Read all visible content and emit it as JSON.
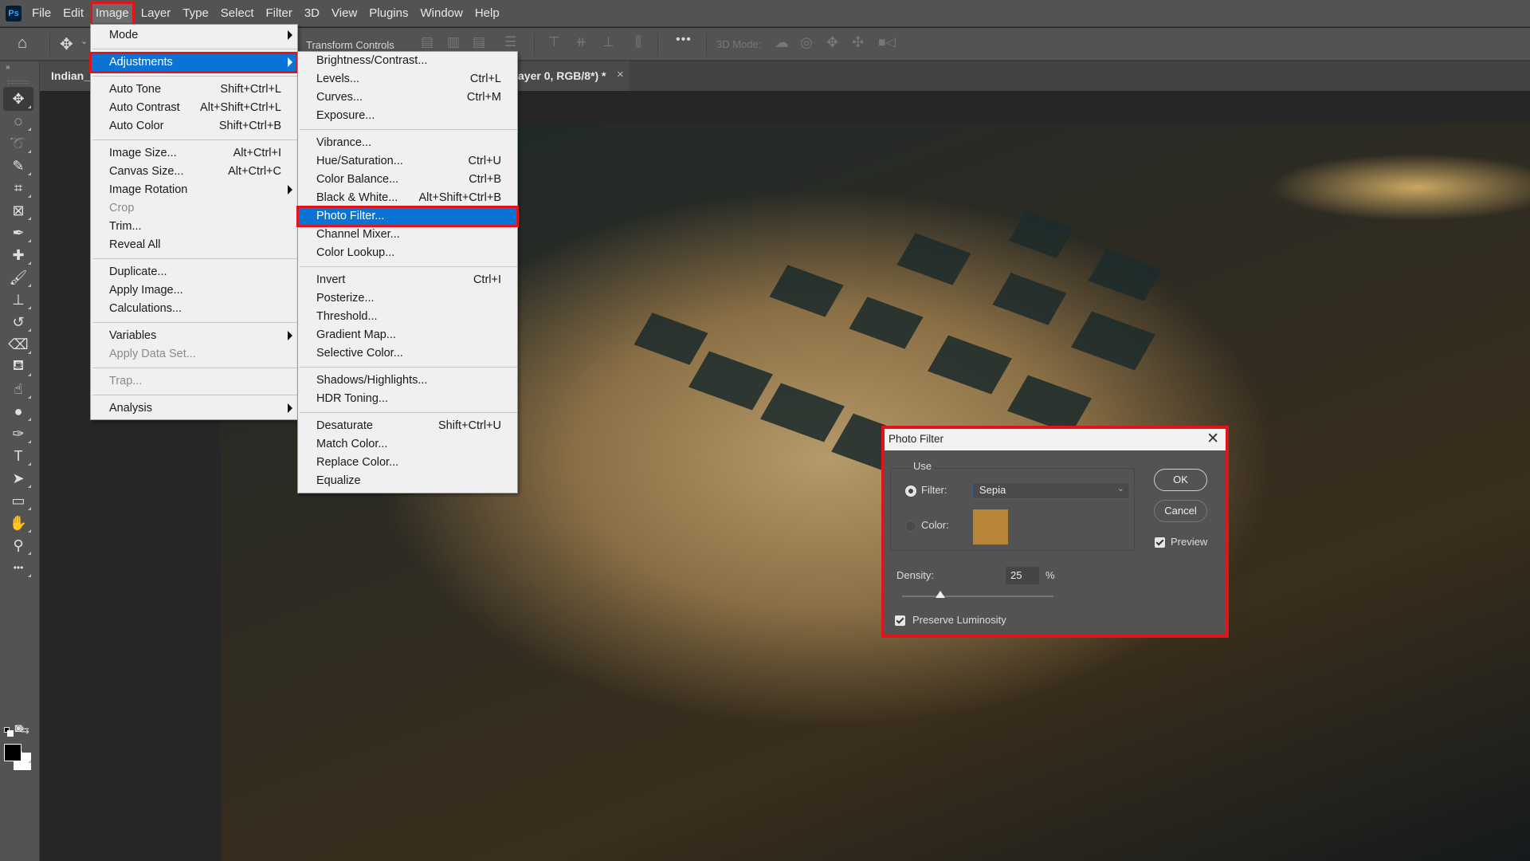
{
  "app": {
    "logo": "Ps"
  },
  "menubar": {
    "items": [
      "File",
      "Edit",
      "Image",
      "Layer",
      "Type",
      "Select",
      "Filter",
      "3D",
      "View",
      "Plugins",
      "Window",
      "Help"
    ],
    "active": "Image"
  },
  "options_bar": {
    "transform_controls_label": "Transform Controls",
    "mode_3d_label": "3D Mode:",
    "icons": [
      "home-icon",
      "move-icon",
      "align-left-icon",
      "align-center-h-icon",
      "align-right-icon",
      "distribute-h-icon",
      "align-top-icon",
      "align-middle-v-icon",
      "align-bottom-icon",
      "distribute-v-icon",
      "more-icon",
      "orbit-3d-icon",
      "roll-3d-icon",
      "pan-3d-icon",
      "slide-3d-icon",
      "scale-3d-icon"
    ]
  },
  "document_tab": {
    "title_prefix": "Indian_",
    "title_suffix": "ayer 0, RGB/8*) *",
    "close": "×"
  },
  "toolbar": {
    "collapse": "»",
    "tools": [
      {
        "name": "move-tool",
        "glyph": "✥"
      },
      {
        "name": "marquee-tool",
        "glyph": "◌"
      },
      {
        "name": "lasso-tool",
        "glyph": "➰"
      },
      {
        "name": "quick-selection-tool",
        "glyph": "✎"
      },
      {
        "name": "crop-tool",
        "glyph": "⌗"
      },
      {
        "name": "frame-tool",
        "glyph": "⊠"
      },
      {
        "name": "eyedropper-tool",
        "glyph": "✒"
      },
      {
        "name": "healing-brush-tool",
        "glyph": "✚"
      },
      {
        "name": "brush-tool",
        "glyph": "🖌"
      },
      {
        "name": "clone-stamp-tool",
        "glyph": "⊥"
      },
      {
        "name": "history-brush-tool",
        "glyph": "↺"
      },
      {
        "name": "eraser-tool",
        "glyph": "⌫"
      },
      {
        "name": "paint-bucket-tool",
        "glyph": "⛾"
      },
      {
        "name": "blur-tool",
        "glyph": "☝"
      },
      {
        "name": "dodge-tool",
        "glyph": "●"
      },
      {
        "name": "pen-tool",
        "glyph": "✑"
      },
      {
        "name": "type-tool",
        "glyph": "T"
      },
      {
        "name": "path-selection-tool",
        "glyph": "➤"
      },
      {
        "name": "rectangle-tool",
        "glyph": "▭"
      },
      {
        "name": "hand-tool",
        "glyph": "✋"
      },
      {
        "name": "zoom-tool",
        "glyph": "⚲"
      },
      {
        "name": "edit-toolbar",
        "glyph": "•••"
      }
    ],
    "foreground_color": "#000000",
    "background_color": "#ffffff"
  },
  "image_menu": {
    "items": [
      {
        "label": "Mode",
        "submenu": true
      },
      {
        "sep": true
      },
      {
        "label": "Adjustments",
        "submenu": true,
        "highlighted": true
      },
      {
        "sep": true
      },
      {
        "label": "Auto Tone",
        "shortcut": "Shift+Ctrl+L"
      },
      {
        "label": "Auto Contrast",
        "shortcut": "Alt+Shift+Ctrl+L"
      },
      {
        "label": "Auto Color",
        "shortcut": "Shift+Ctrl+B"
      },
      {
        "sep": true
      },
      {
        "label": "Image Size...",
        "shortcut": "Alt+Ctrl+I"
      },
      {
        "label": "Canvas Size...",
        "shortcut": "Alt+Ctrl+C"
      },
      {
        "label": "Image Rotation",
        "submenu": true
      },
      {
        "label": "Crop",
        "disabled": true
      },
      {
        "label": "Trim..."
      },
      {
        "label": "Reveal All"
      },
      {
        "sep": true
      },
      {
        "label": "Duplicate..."
      },
      {
        "label": "Apply Image..."
      },
      {
        "label": "Calculations..."
      },
      {
        "sep": true
      },
      {
        "label": "Variables",
        "submenu": true
      },
      {
        "label": "Apply Data Set...",
        "disabled": true
      },
      {
        "sep": true
      },
      {
        "label": "Trap...",
        "disabled": true
      },
      {
        "sep": true
      },
      {
        "label": "Analysis",
        "submenu": true
      }
    ]
  },
  "adjustments_menu": {
    "items": [
      {
        "label": "Brightness/Contrast..."
      },
      {
        "label": "Levels...",
        "shortcut": "Ctrl+L"
      },
      {
        "label": "Curves...",
        "shortcut": "Ctrl+M"
      },
      {
        "label": "Exposure..."
      },
      {
        "sep": true
      },
      {
        "label": "Vibrance..."
      },
      {
        "label": "Hue/Saturation...",
        "shortcut": "Ctrl+U"
      },
      {
        "label": "Color Balance...",
        "shortcut": "Ctrl+B"
      },
      {
        "label": "Black & White...",
        "shortcut": "Alt+Shift+Ctrl+B"
      },
      {
        "label": "Photo Filter...",
        "highlighted": true
      },
      {
        "label": "Channel Mixer..."
      },
      {
        "label": "Color Lookup..."
      },
      {
        "sep": true
      },
      {
        "label": "Invert",
        "shortcut": "Ctrl+I"
      },
      {
        "label": "Posterize..."
      },
      {
        "label": "Threshold..."
      },
      {
        "label": "Gradient Map..."
      },
      {
        "label": "Selective Color..."
      },
      {
        "sep": true
      },
      {
        "label": "Shadows/Highlights..."
      },
      {
        "label": "HDR Toning..."
      },
      {
        "sep": true
      },
      {
        "label": "Desaturate",
        "shortcut": "Shift+Ctrl+U"
      },
      {
        "label": "Match Color..."
      },
      {
        "label": "Replace Color..."
      },
      {
        "label": "Equalize"
      }
    ]
  },
  "photo_filter_dialog": {
    "title": "Photo Filter",
    "use_label": "Use",
    "filter_label": "Filter:",
    "filter_value": "Sepia",
    "filter_selected": true,
    "color_label": "Color:",
    "color_value": "#b8843a",
    "ok_label": "OK",
    "cancel_label": "Cancel",
    "preview_label": "Preview",
    "preview_checked": true,
    "density_label": "Density:",
    "density_value": "25",
    "density_unit": "%",
    "density_percent": 25,
    "preserve_luminosity_label": "Preserve Luminosity",
    "preserve_luminosity_checked": true
  },
  "highlight_color": "#e0141b",
  "menu_highlight_color": "#0a74d6"
}
